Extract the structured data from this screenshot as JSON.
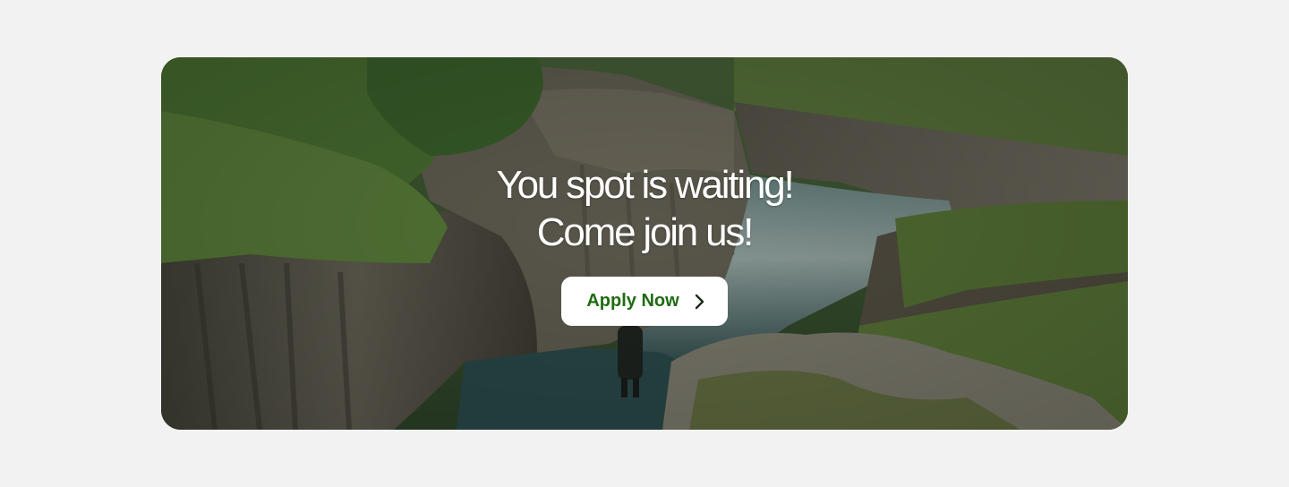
{
  "banner": {
    "headline_line1": "You spot is waiting!",
    "headline_line2": "Come join us!",
    "cta_label": "Apply Now",
    "cta_icon": "chevron-right-icon",
    "cta_text_color": "#1f6b12",
    "cta_background": "#ffffff",
    "background_image": "canyon-landscape-photo"
  },
  "page": {
    "background_color": "#f2f2f2"
  }
}
